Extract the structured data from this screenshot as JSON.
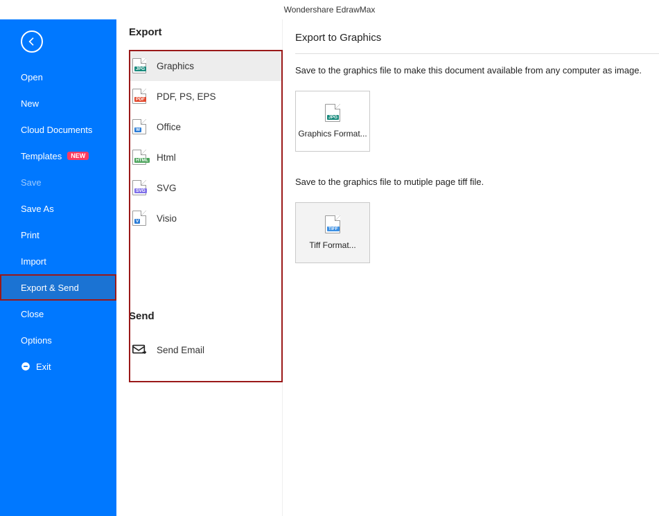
{
  "app": {
    "title": "Wondershare EdrawMax"
  },
  "sidebar": {
    "items": [
      {
        "label": "Open",
        "name": "sidebar-item-open"
      },
      {
        "label": "New",
        "name": "sidebar-item-new"
      },
      {
        "label": "Cloud Documents",
        "name": "sidebar-item-cloud-documents"
      },
      {
        "label": "Templates",
        "name": "sidebar-item-templates",
        "badge": "NEW"
      },
      {
        "label": "Save",
        "name": "sidebar-item-save",
        "disabled": true
      },
      {
        "label": "Save As",
        "name": "sidebar-item-save-as"
      },
      {
        "label": "Print",
        "name": "sidebar-item-print"
      },
      {
        "label": "Import",
        "name": "sidebar-item-import"
      },
      {
        "label": "Export & Send",
        "name": "sidebar-item-export-send",
        "selected": true,
        "highlighted": true
      },
      {
        "label": "Close",
        "name": "sidebar-item-close"
      },
      {
        "label": "Options",
        "name": "sidebar-item-options"
      },
      {
        "label": "Exit",
        "name": "sidebar-item-exit",
        "icon": "exit"
      }
    ]
  },
  "export": {
    "heading": "Export",
    "items": [
      {
        "label": "Graphics",
        "badge": "JPG",
        "color": "#188a7c",
        "selected": true,
        "name": "export-item-graphics"
      },
      {
        "label": "PDF, PS, EPS",
        "badge": "PDF",
        "color": "#e2482d",
        "name": "export-item-pdf"
      },
      {
        "label": "Office",
        "badge": "W",
        "color": "#2b7cd6",
        "name": "export-item-office"
      },
      {
        "label": "Html",
        "badge": "HTML",
        "color": "#4aa35a",
        "name": "export-item-html"
      },
      {
        "label": "SVG",
        "badge": "SVG",
        "color": "#7e6ee8",
        "name": "export-item-svg"
      },
      {
        "label": "Visio",
        "badge": "V",
        "color": "#2b7cd6",
        "name": "export-item-visio"
      }
    ]
  },
  "send": {
    "heading": "Send",
    "items": [
      {
        "label": "Send Email",
        "name": "send-item-email"
      }
    ]
  },
  "detail": {
    "title": "Export to Graphics",
    "desc1": "Save to the graphics file to make this document available from any computer as image.",
    "tile1": {
      "badge": "JPG",
      "color": "#188a7c",
      "label": "Graphics\nFormat..."
    },
    "desc2": "Save to the graphics file to mutiple page tiff file.",
    "tile2": {
      "badge": "TIFF",
      "color": "#3a8fe3",
      "label": "Tiff\nFormat..."
    }
  }
}
